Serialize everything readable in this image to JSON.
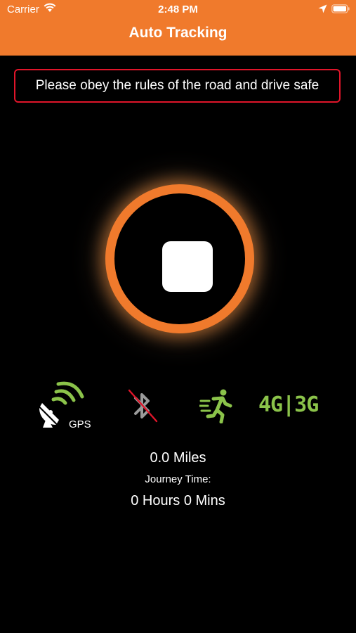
{
  "status_bar": {
    "carrier": "Carrier",
    "time": "2:48 PM",
    "icons": [
      "wifi-icon",
      "location-arrow-icon",
      "battery-icon"
    ]
  },
  "nav": {
    "title": "Auto Tracking"
  },
  "notice": {
    "text": "Please obey the rules of the road and drive safe",
    "border_color": "#E0152A"
  },
  "tracking_control": {
    "icon": "stop-icon",
    "ring_color": "#F07A2C"
  },
  "indicators": {
    "gps": {
      "icon": "satellite-dish-icon",
      "label": "GPS",
      "status_color": "#8BC34A"
    },
    "bluetooth": {
      "icon": "bluetooth-disabled-icon",
      "status": "disabled"
    },
    "activity": {
      "icon": "running-person-icon",
      "status_color": "#8BC34A"
    },
    "network": {
      "label": "4G|3G",
      "status_color": "#8BC34A"
    }
  },
  "stats": {
    "distance": "0.0 Miles",
    "journey_label": "Journey Time:",
    "journey_time": "0 Hours 0 Mins"
  },
  "colors": {
    "accent": "#F07A2C",
    "background": "#000000",
    "active": "#8BC34A",
    "alert": "#E0152A"
  }
}
